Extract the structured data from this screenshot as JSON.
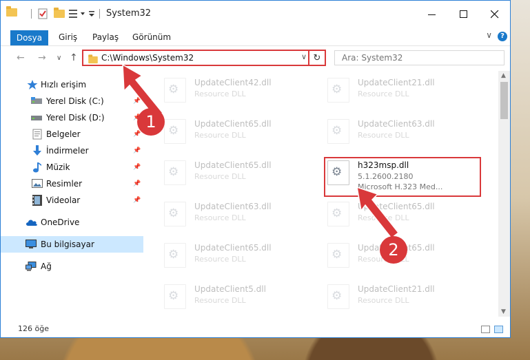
{
  "window": {
    "title": "System32"
  },
  "ribbon": {
    "tabs": [
      "Dosya",
      "Giriş",
      "Paylaş",
      "Görünüm"
    ],
    "help": "?",
    "expand": "∨"
  },
  "nav": {
    "back": "←",
    "forward": "→",
    "recent": "∨",
    "up": "↑",
    "address": "C:\\Windows\\System32",
    "address_drop": "∨",
    "refresh": "↻",
    "search_placeholder": "Ara: System32"
  },
  "sidebar": {
    "items": [
      {
        "label": "Hızlı erişim",
        "icon": "star-icon",
        "pinned": false
      },
      {
        "label": "Yerel Disk (C:)",
        "icon": "disk-icon",
        "pinned": true
      },
      {
        "label": "Yerel Disk (D:)",
        "icon": "disk-icon",
        "pinned": true
      },
      {
        "label": "Belgeler",
        "icon": "documents-icon",
        "pinned": true
      },
      {
        "label": "İndirmeler",
        "icon": "download-icon",
        "pinned": true
      },
      {
        "label": "Müzik",
        "icon": "music-icon",
        "pinned": true
      },
      {
        "label": "Resimler",
        "icon": "pictures-icon",
        "pinned": true
      },
      {
        "label": "Videolar",
        "icon": "videos-icon",
        "pinned": true
      },
      {
        "label": "OneDrive",
        "icon": "cloud-icon",
        "pinned": false
      },
      {
        "label": "Bu bilgisayar",
        "icon": "computer-icon",
        "pinned": false,
        "selected": true
      },
      {
        "label": "Ağ",
        "icon": "network-icon",
        "pinned": false
      }
    ],
    "pin_glyph": "📌"
  },
  "files": {
    "left": [
      {
        "name": "UpdateClient42.dll",
        "type": "Resource DLL"
      },
      {
        "name": "UpdateClient65.dll",
        "type": "Resource DLL"
      },
      {
        "name": "UpdateClient65.dll",
        "type": "Resource DLL"
      },
      {
        "name": "UpdateClient63.dll",
        "type": "Resource DLL"
      },
      {
        "name": "UpdateClient65.dll",
        "type": "Resource DLL"
      },
      {
        "name": "UpdateClient5.dll",
        "type": "Resource DLL"
      }
    ],
    "right": [
      {
        "name": "UpdateClient21.dll",
        "type": "Resource DLL"
      },
      {
        "name": "UpdateClient63.dll",
        "type": "Resource DLL"
      },
      {
        "name": "h323msp.dll",
        "type": "5.1.2600.2180",
        "desc": "Microsoft H.323 Med...",
        "highlighted": true
      },
      {
        "name": "UpdateClient65.dll",
        "type": "Resource DLL"
      },
      {
        "name": "UpdateClient65.dll",
        "type": "Resource DLL"
      },
      {
        "name": "UpdateClient21.dll",
        "type": "Resource DLL"
      }
    ]
  },
  "status": {
    "count": "126 öğe"
  },
  "annotations": {
    "badge1": "1",
    "badge2": "2",
    "color": "#d9383a"
  },
  "colors": {
    "accent": "#1979ca",
    "highlight": "#d9383a",
    "selection": "#cce8ff"
  }
}
